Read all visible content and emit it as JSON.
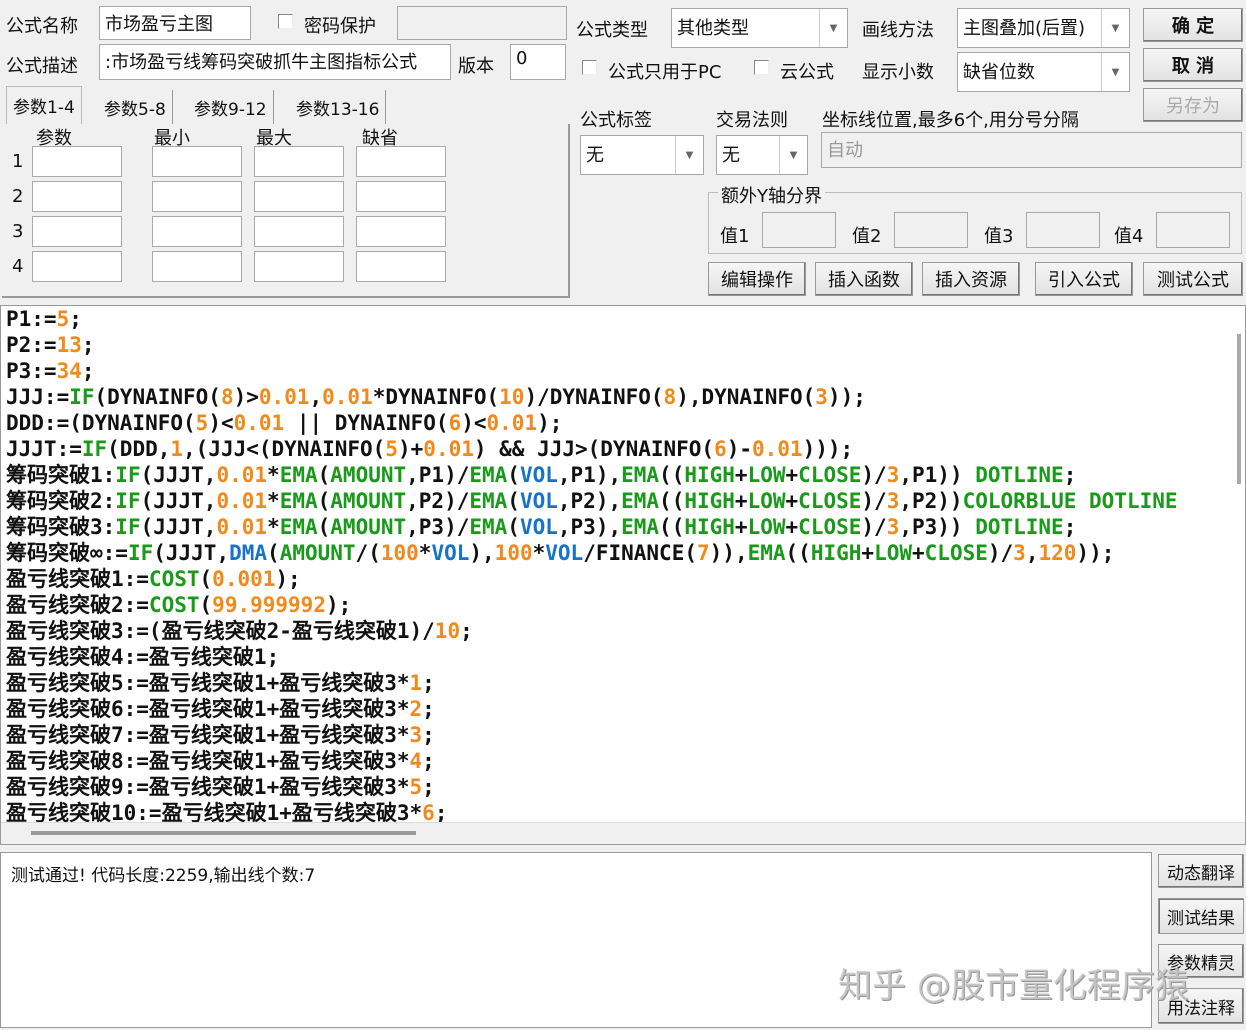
{
  "header": {
    "name_label": "公式名称",
    "name_value": "市场盈亏主图",
    "password_label": "密码保护",
    "desc_label": "公式描述",
    "desc_value": "市场盈亏线筹码突破抓牛主图指标公式:",
    "version_label": "版本",
    "version_value": "0",
    "type_label": "公式类型",
    "type_value": "其他类型",
    "draw_label": "画线方法",
    "draw_value": "主图叠加(后置)",
    "pc_only_label": "公式只用于PC",
    "cloud_label": "云公式",
    "decimal_label": "显示小数",
    "decimal_value": "缺省位数",
    "tag_label": "公式标签",
    "tag_value": "无",
    "rule_label": "交易法则",
    "rule_value": "无",
    "axis_label": "坐标线位置,最多6个,用分号分隔",
    "axis_placeholder": "自动",
    "yaxis_group": "额外Y轴分界",
    "y_values": [
      "值1",
      "值2",
      "值3",
      "值4"
    ]
  },
  "buttons": {
    "ok": "确  定",
    "cancel": "取  消",
    "save_as": "另存为",
    "edit": "编辑操作",
    "insert_func": "插入函数",
    "insert_res": "插入资源",
    "import": "引入公式",
    "test": "测试公式",
    "translate": "动态翻译",
    "test_result": "测试结果",
    "param_wizard": "参数精灵",
    "usage": "用法注释"
  },
  "params": {
    "tabs": [
      "参数1-4",
      "参数5-8",
      "参数9-12",
      "参数13-16"
    ],
    "columns": [
      "参数",
      "最小",
      "最大",
      "缺省"
    ],
    "rows": [
      "1",
      "2",
      "3",
      "4"
    ]
  },
  "code": [
    [
      [
        "P1:=",
        "k"
      ],
      [
        "5",
        "o"
      ],
      [
        ";",
        "k"
      ]
    ],
    [
      [
        "P2:=",
        "k"
      ],
      [
        "13",
        "o"
      ],
      [
        ";",
        "k"
      ]
    ],
    [
      [
        "P3:=",
        "k"
      ],
      [
        "34",
        "o"
      ],
      [
        ";",
        "k"
      ]
    ],
    [
      [
        "JJJ:=",
        "k"
      ],
      [
        "IF",
        "g"
      ],
      [
        "(DYNAINFO(",
        "k"
      ],
      [
        "8",
        "o"
      ],
      [
        ")>",
        "k"
      ],
      [
        "0.01",
        "o"
      ],
      [
        ",",
        "k"
      ],
      [
        "0.01",
        "o"
      ],
      [
        "*DYNAINFO(",
        "k"
      ],
      [
        "10",
        "o"
      ],
      [
        ")/DYNAINFO(",
        "k"
      ],
      [
        "8",
        "o"
      ],
      [
        "),DYNAINFO(",
        "k"
      ],
      [
        "3",
        "o"
      ],
      [
        "));",
        "k"
      ]
    ],
    [
      [
        "DDD:=(DYNAINFO(",
        "k"
      ],
      [
        "5",
        "o"
      ],
      [
        ")<",
        "k"
      ],
      [
        "0.01",
        "o"
      ],
      [
        " || DYNAINFO(",
        "k"
      ],
      [
        "6",
        "o"
      ],
      [
        ")<",
        "k"
      ],
      [
        "0.01",
        "o"
      ],
      [
        ");",
        "k"
      ]
    ],
    [
      [
        "JJJT:=",
        "k"
      ],
      [
        "IF",
        "g"
      ],
      [
        "(DDD,",
        "k"
      ],
      [
        "1",
        "o"
      ],
      [
        ",(JJJ<(DYNAINFO(",
        "k"
      ],
      [
        "5",
        "o"
      ],
      [
        ")+",
        "k"
      ],
      [
        "0.01",
        "o"
      ],
      [
        ") && JJJ>(DYNAINFO(",
        "k"
      ],
      [
        "6",
        "o"
      ],
      [
        ")-",
        "k"
      ],
      [
        "0.01",
        "o"
      ],
      [
        ")));",
        "k"
      ]
    ],
    [
      [
        "筹码突破1:",
        "k"
      ],
      [
        "IF",
        "g"
      ],
      [
        "(JJJT,",
        "k"
      ],
      [
        "0.01",
        "o"
      ],
      [
        "*",
        "k"
      ],
      [
        "EMA",
        "g"
      ],
      [
        "(",
        "k"
      ],
      [
        "AMOUNT",
        "g"
      ],
      [
        ",P1)/",
        "k"
      ],
      [
        "EMA",
        "g"
      ],
      [
        "(",
        "k"
      ],
      [
        "VOL",
        "b"
      ],
      [
        ",P1),",
        "k"
      ],
      [
        "EMA",
        "g"
      ],
      [
        "((",
        "k"
      ],
      [
        "HIGH",
        "g"
      ],
      [
        "+",
        "k"
      ],
      [
        "LOW",
        "g"
      ],
      [
        "+",
        "k"
      ],
      [
        "CLOSE",
        "g"
      ],
      [
        ")/",
        "k"
      ],
      [
        "3",
        "o"
      ],
      [
        ",P1)) ",
        "k"
      ],
      [
        "DOTLINE",
        "g"
      ],
      [
        ";",
        "k"
      ]
    ],
    [
      [
        "筹码突破2:",
        "k"
      ],
      [
        "IF",
        "g"
      ],
      [
        "(JJJT,",
        "k"
      ],
      [
        "0.01",
        "o"
      ],
      [
        "*",
        "k"
      ],
      [
        "EMA",
        "g"
      ],
      [
        "(",
        "k"
      ],
      [
        "AMOUNT",
        "g"
      ],
      [
        ",P2)/",
        "k"
      ],
      [
        "EMA",
        "g"
      ],
      [
        "(",
        "k"
      ],
      [
        "VOL",
        "b"
      ],
      [
        ",P2),",
        "k"
      ],
      [
        "EMA",
        "g"
      ],
      [
        "((",
        "k"
      ],
      [
        "HIGH",
        "g"
      ],
      [
        "+",
        "k"
      ],
      [
        "LOW",
        "g"
      ],
      [
        "+",
        "k"
      ],
      [
        "CLOSE",
        "g"
      ],
      [
        ")/",
        "k"
      ],
      [
        "3",
        "o"
      ],
      [
        ",P2))",
        "k"
      ],
      [
        "COLORBLUE",
        "g"
      ],
      [
        " ",
        "k"
      ],
      [
        "DOTLINE",
        "g"
      ]
    ],
    [
      [
        "筹码突破3:",
        "k"
      ],
      [
        "IF",
        "g"
      ],
      [
        "(JJJT,",
        "k"
      ],
      [
        "0.01",
        "o"
      ],
      [
        "*",
        "k"
      ],
      [
        "EMA",
        "g"
      ],
      [
        "(",
        "k"
      ],
      [
        "AMOUNT",
        "g"
      ],
      [
        ",P3)/",
        "k"
      ],
      [
        "EMA",
        "g"
      ],
      [
        "(",
        "k"
      ],
      [
        "VOL",
        "b"
      ],
      [
        ",P3),",
        "k"
      ],
      [
        "EMA",
        "g"
      ],
      [
        "((",
        "k"
      ],
      [
        "HIGH",
        "g"
      ],
      [
        "+",
        "k"
      ],
      [
        "LOW",
        "g"
      ],
      [
        "+",
        "k"
      ],
      [
        "CLOSE",
        "g"
      ],
      [
        ")/",
        "k"
      ],
      [
        "3",
        "o"
      ],
      [
        ",P3)) ",
        "k"
      ],
      [
        "DOTLINE",
        "g"
      ],
      [
        ";",
        "k"
      ]
    ],
    [
      [
        "筹码突破∞:=",
        "k"
      ],
      [
        "IF",
        "g"
      ],
      [
        "(JJJT,",
        "k"
      ],
      [
        "DMA",
        "b"
      ],
      [
        "(",
        "k"
      ],
      [
        "AMOUNT",
        "g"
      ],
      [
        "/(",
        "k"
      ],
      [
        "100",
        "o"
      ],
      [
        "*",
        "k"
      ],
      [
        "VOL",
        "b"
      ],
      [
        "),",
        "k"
      ],
      [
        "100",
        "o"
      ],
      [
        "*",
        "k"
      ],
      [
        "VOL",
        "b"
      ],
      [
        "/FINANCE(",
        "k"
      ],
      [
        "7",
        "o"
      ],
      [
        ")),",
        "k"
      ],
      [
        "EMA",
        "g"
      ],
      [
        "((",
        "k"
      ],
      [
        "HIGH",
        "g"
      ],
      [
        "+",
        "k"
      ],
      [
        "LOW",
        "g"
      ],
      [
        "+",
        "k"
      ],
      [
        "CLOSE",
        "g"
      ],
      [
        ")/",
        "k"
      ],
      [
        "3",
        "o"
      ],
      [
        ",",
        "k"
      ],
      [
        "120",
        "o"
      ],
      [
        "));",
        "k"
      ]
    ],
    [
      [
        "盈亏线突破1:=",
        "k"
      ],
      [
        "COST",
        "g"
      ],
      [
        "(",
        "k"
      ],
      [
        "0.001",
        "o"
      ],
      [
        ");",
        "k"
      ]
    ],
    [
      [
        "盈亏线突破2:=",
        "k"
      ],
      [
        "COST",
        "g"
      ],
      [
        "(",
        "k"
      ],
      [
        "99.999992",
        "o"
      ],
      [
        ");",
        "k"
      ]
    ],
    [
      [
        "盈亏线突破3:=(盈亏线突破2-盈亏线突破1)/",
        "k"
      ],
      [
        "10",
        "o"
      ],
      [
        ";",
        "k"
      ]
    ],
    [
      [
        "盈亏线突破4:=盈亏线突破1;",
        "k"
      ]
    ],
    [
      [
        "盈亏线突破5:=盈亏线突破1+盈亏线突破3*",
        "k"
      ],
      [
        "1",
        "o"
      ],
      [
        ";",
        "k"
      ]
    ],
    [
      [
        "盈亏线突破6:=盈亏线突破1+盈亏线突破3*",
        "k"
      ],
      [
        "2",
        "o"
      ],
      [
        ";",
        "k"
      ]
    ],
    [
      [
        "盈亏线突破7:=盈亏线突破1+盈亏线突破3*",
        "k"
      ],
      [
        "3",
        "o"
      ],
      [
        ";",
        "k"
      ]
    ],
    [
      [
        "盈亏线突破8:=盈亏线突破1+盈亏线突破3*",
        "k"
      ],
      [
        "4",
        "o"
      ],
      [
        ";",
        "k"
      ]
    ],
    [
      [
        "盈亏线突破9:=盈亏线突破1+盈亏线突破3*",
        "k"
      ],
      [
        "5",
        "o"
      ],
      [
        ";",
        "k"
      ]
    ],
    [
      [
        "盈亏线突破10:=盈亏线突破1+盈亏线突破3*",
        "k"
      ],
      [
        "6",
        "o"
      ],
      [
        ";",
        "k"
      ]
    ]
  ],
  "output": {
    "message": "测试通过! 代码长度:2259,输出线个数:7"
  },
  "watermark": "知乎 @股市量化程序猿",
  "colors": {
    "keyword": "#1a9a1a",
    "number": "#f08a1c",
    "variable": "#1673c9"
  }
}
